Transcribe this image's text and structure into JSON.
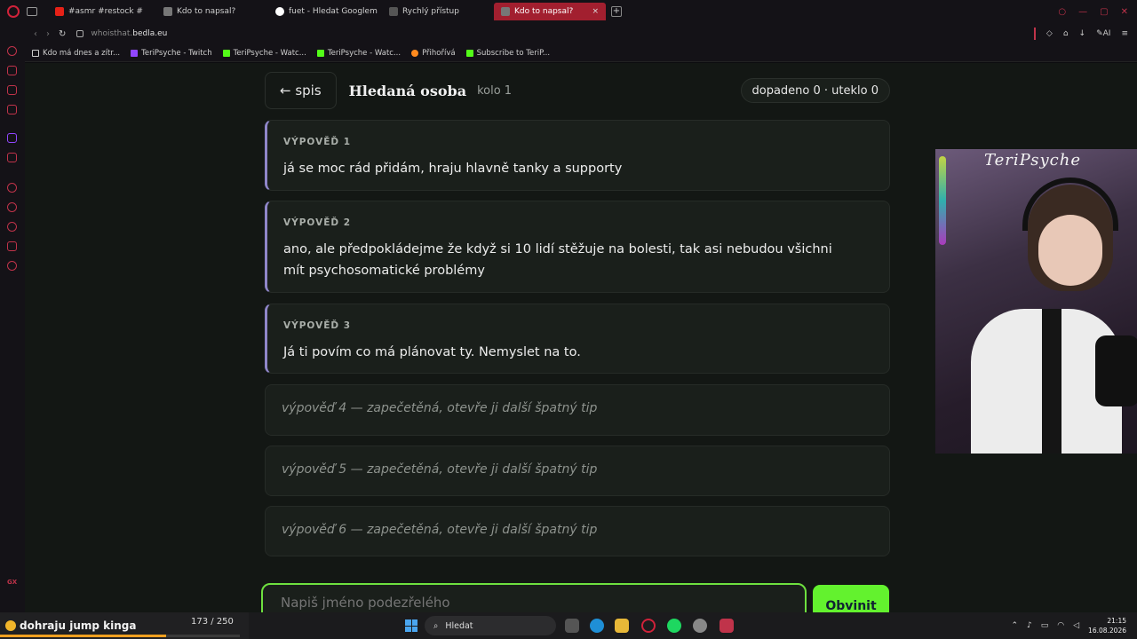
{
  "browser": {
    "tabs": [
      {
        "label": "#asmr #restock #",
        "active": false
      },
      {
        "label": "Kdo to napsal?",
        "active": false
      },
      {
        "label": "fuet - Hledat Googlem",
        "active": false
      },
      {
        "label": "Rychlý přístup",
        "active": false
      },
      {
        "label": "Kdo to napsal?",
        "active": true
      }
    ],
    "new_tab": "+",
    "url_prefix": "whoisthat.",
    "url_host": "bedla.eu",
    "ai_label": "AI",
    "bookmarks": [
      {
        "label": "Kdo má dnes a zítr...",
        "color": "#cccccc"
      },
      {
        "label": "TeriPsyche - Twitch",
        "color": "#9146ff"
      },
      {
        "label": "TeriPsyche - Watc...",
        "color": "#53fc18"
      },
      {
        "label": "TeriPsyche - Watc...",
        "color": "#53fc18"
      },
      {
        "label": "Přihořívá",
        "color": "#ff8a1e"
      },
      {
        "label": "Subscribe to TeriP...",
        "color": "#53fc18"
      }
    ]
  },
  "game": {
    "back_label": "← spis",
    "title": "Hledaná osoba",
    "round": "kolo 1",
    "score": "dopadeno 0 · uteklo 0",
    "statements": [
      {
        "label": "VÝPOVĚĎ 1",
        "text": "já se moc rád přidám, hraju hlavně tanky a supporty"
      },
      {
        "label": "VÝPOVĚĎ 2",
        "text": "ano, ale předpokládejme že když si 10 lidí stěžuje na bolesti, tak asi nebudou všichni mít psychosomatické problémy"
      },
      {
        "label": "VÝPOVĚĎ 3",
        "text": "Já ti povím co má plánovat ty. Nemyslet na to."
      }
    ],
    "sealed": [
      "výpověď 4 — zapečetěná, otevře ji další špatný tip",
      "výpověď 5 — zapečetěná, otevře ji další špatný tip",
      "výpověď 6 — zapečetěná, otevře ji další špatný tip"
    ],
    "input_placeholder": "Napiš jméno podezřelého",
    "accuse_label": "Obvinit",
    "accent_color": "#63f22e"
  },
  "webcam": {
    "name": "TeriPsyche"
  },
  "taskbar": {
    "now_playing": "dohraju jump kinga",
    "count": "173 / 250",
    "progress": 0.692,
    "search": "Hledat",
    "time": "21:15",
    "date": "16.08.2026"
  }
}
